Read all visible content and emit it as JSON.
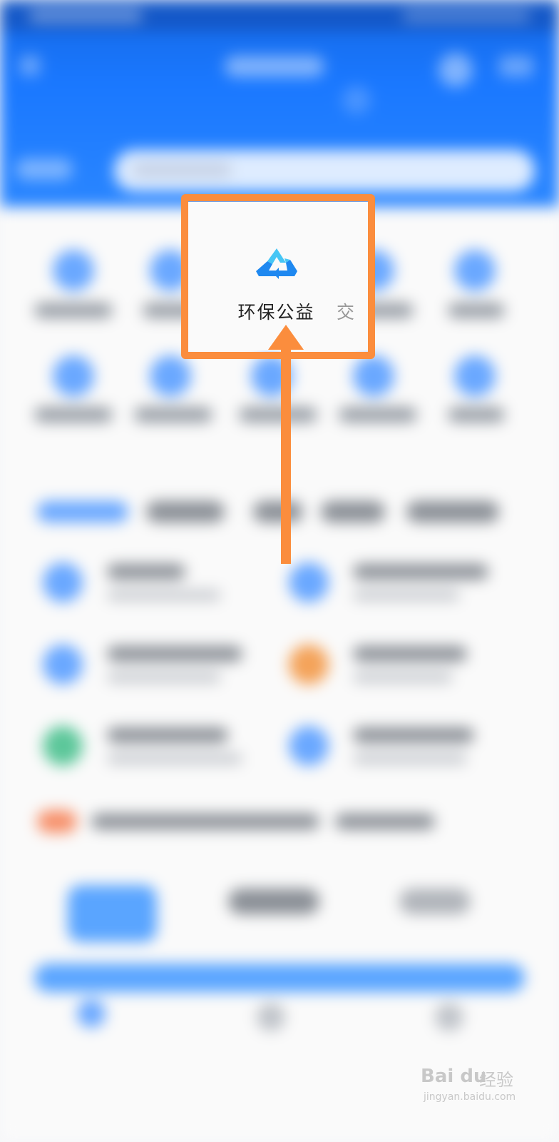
{
  "highlighted_item": {
    "label": "环保公益",
    "icon": "recycle-icon",
    "next_label_partial": "交"
  },
  "annotation": {
    "box_color": "#fb8d3d",
    "arrow_color": "#fb8d3d"
  },
  "colors": {
    "header_blue": "#1a78ff",
    "icon_blue": "#1e88f0",
    "icon_light_blue": "#46c6f5"
  },
  "watermark": {
    "logo": "Bai du",
    "cn": "经验",
    "url": "jingyan.baidu.com"
  }
}
